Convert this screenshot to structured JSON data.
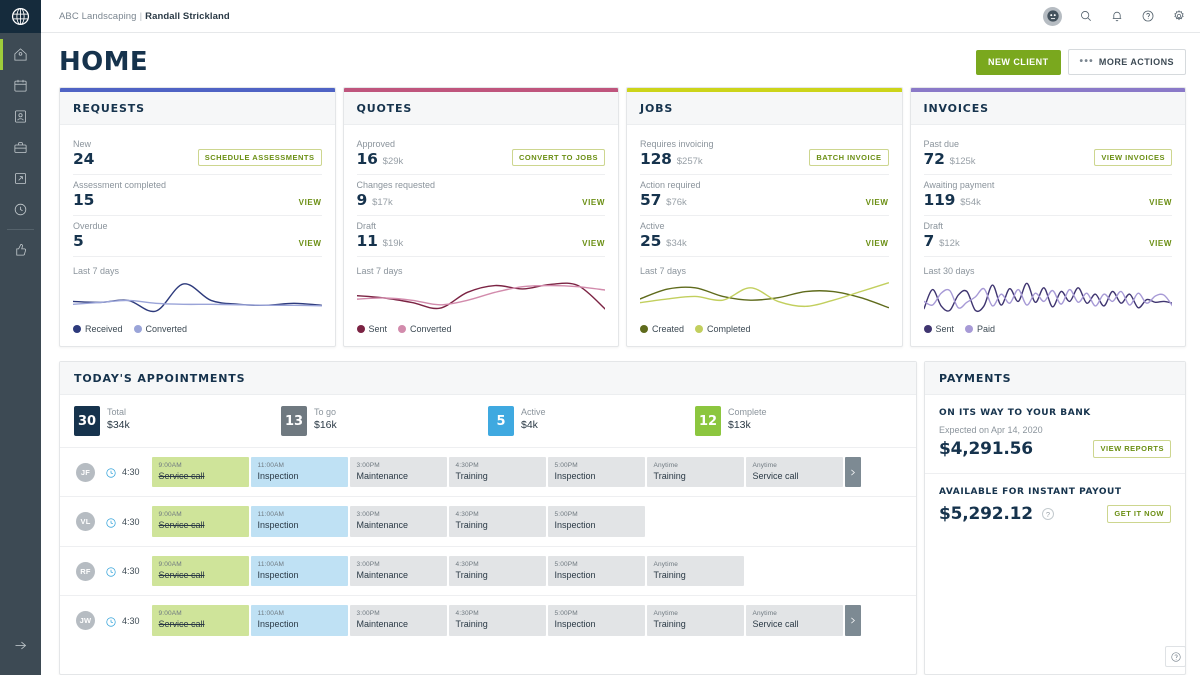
{
  "sidebar": {
    "logo_icon": "jobber-logo-icon",
    "items": [
      {
        "icon": "home-icon",
        "name": "home",
        "active": true
      },
      {
        "icon": "calendar-icon",
        "name": "schedule",
        "active": false
      },
      {
        "icon": "clients-icon",
        "name": "clients",
        "active": false
      },
      {
        "icon": "briefcase-icon",
        "name": "jobs",
        "active": false
      },
      {
        "icon": "invoice-icon",
        "name": "invoices",
        "active": false
      },
      {
        "icon": "clock-icon",
        "name": "timesheets",
        "active": false
      },
      {
        "icon": "thumbs-up-icon",
        "name": "reviews",
        "active": false
      }
    ],
    "expand_icon": "arrow-right-icon"
  },
  "topbar": {
    "company": "ABC Landscaping",
    "separator": "|",
    "user": "Randall Strickland",
    "icons": [
      "avatar-icon",
      "search-icon",
      "bell-icon",
      "help-circle-icon",
      "gear-icon"
    ]
  },
  "header": {
    "title": "HOME",
    "new_client_label": "NEW CLIENT",
    "more_actions_label": "MORE ACTIONS",
    "more_actions_dots": "•••"
  },
  "colors": {
    "requests_accent": "#4f63c4",
    "quotes_accent": "#bf557d",
    "jobs_accent": "#ccd41a",
    "invoices_accent": "#8a79c8",
    "green_primary": "#7aa81e",
    "navy": "#16334d"
  },
  "cards": [
    {
      "title": "REQUESTS",
      "accent": "#4f63c4",
      "stats": [
        {
          "label": "New",
          "value": "24",
          "amount": "",
          "action": "SCHEDULE ASSESSMENTS",
          "action_type": "pill"
        },
        {
          "label": "Assessment completed",
          "value": "15",
          "amount": "",
          "action": "VIEW",
          "action_type": "link"
        },
        {
          "label": "Overdue",
          "value": "5",
          "amount": "",
          "action": "VIEW",
          "action_type": "link"
        }
      ],
      "chart_data": {
        "type": "line",
        "title": "Last 7 days",
        "x": [
          0,
          1,
          2,
          3,
          4,
          5,
          6,
          7,
          8,
          9
        ],
        "series": [
          {
            "name": "Received",
            "color": "#2d3a7c",
            "values": [
              28,
              26,
              30,
              8,
              64,
              30,
              22,
              20,
              24,
              20
            ]
          },
          {
            "name": "Converted",
            "color": "#9aa4d8",
            "values": [
              22,
              26,
              30,
              24,
              22,
              22,
              21,
              20,
              20,
              19
            ]
          }
        ],
        "ylim": [
          0,
          70
        ],
        "grid": false,
        "legend": "bottom"
      }
    },
    {
      "title": "QUOTES",
      "accent": "#bf557d",
      "stats": [
        {
          "label": "Approved",
          "value": "16",
          "amount": "$29k",
          "action": "CONVERT TO JOBS",
          "action_type": "pill"
        },
        {
          "label": "Changes requested",
          "value": "9",
          "amount": "$17k",
          "action": "VIEW",
          "action_type": "link"
        },
        {
          "label": "Draft",
          "value": "11",
          "amount": "$19k",
          "action": "VIEW",
          "action_type": "link"
        }
      ],
      "chart_data": {
        "type": "line",
        "title": "Last 7 days",
        "x": [
          0,
          1,
          2,
          3,
          4,
          5,
          6,
          7,
          8,
          9
        ],
        "series": [
          {
            "name": "Sent",
            "color": "#7b2343",
            "values": [
              34,
              30,
              22,
              12,
              40,
              52,
              46,
              54,
              52,
              10
            ]
          },
          {
            "name": "Converted",
            "color": "#d28bac",
            "values": [
              28,
              30,
              26,
              18,
              26,
              40,
              50,
              52,
              50,
              44
            ]
          }
        ],
        "ylim": [
          0,
          60
        ],
        "grid": false,
        "legend": "bottom"
      }
    },
    {
      "title": "JOBS",
      "accent": "#ccd41a",
      "stats": [
        {
          "label": "Requires invoicing",
          "value": "128",
          "amount": "$257k",
          "action": "BATCH INVOICE",
          "action_type": "pill"
        },
        {
          "label": "Action required",
          "value": "57",
          "amount": "$76k",
          "action": "VIEW",
          "action_type": "link"
        },
        {
          "label": "Active",
          "value": "25",
          "amount": "$34k",
          "action": "VIEW",
          "action_type": "link"
        }
      ],
      "chart_data": {
        "type": "line",
        "title": "Last 7 days",
        "x": [
          0,
          1,
          2,
          3,
          4,
          5,
          6,
          7,
          8,
          9
        ],
        "series": [
          {
            "name": "Created",
            "color": "#5f6b1c",
            "values": [
              26,
              42,
              44,
              30,
              24,
              28,
              38,
              38,
              28,
              12
            ]
          },
          {
            "name": "Completed",
            "color": "#c2cf5e",
            "values": [
              20,
              26,
              30,
              24,
              44,
              22,
              14,
              24,
              38,
              52
            ]
          }
        ],
        "ylim": [
          0,
          55
        ],
        "grid": false,
        "legend": "bottom"
      }
    },
    {
      "title": "INVOICES",
      "accent": "#8a79c8",
      "stats": [
        {
          "label": "Past due",
          "value": "72",
          "amount": "$125k",
          "action": "VIEW INVOICES",
          "action_type": "pill"
        },
        {
          "label": "Awaiting payment",
          "value": "119",
          "amount": "$54k",
          "action": "VIEW",
          "action_type": "link"
        },
        {
          "label": "Draft",
          "value": "7",
          "amount": "$12k",
          "action": "VIEW",
          "action_type": "link"
        }
      ],
      "chart_data": {
        "type": "line",
        "title": "Last 30 days",
        "x": [
          0,
          1,
          2,
          3,
          4,
          5,
          6,
          7,
          8,
          9,
          10,
          11,
          12,
          13,
          14,
          15,
          16,
          17,
          18,
          19,
          20,
          21,
          22,
          23,
          24,
          25,
          26,
          27,
          28,
          29
        ],
        "series": [
          {
            "name": "Sent",
            "color": "#3f3570",
            "values": [
              14,
              56,
              20,
              10,
              44,
              52,
              10,
              20,
              66,
              22,
              58,
              30,
              70,
              28,
              60,
              18,
              52,
              30,
              60,
              26,
              46,
              20,
              52,
              26,
              46,
              16,
              34,
              28,
              30,
              26
            ]
          },
          {
            "name": "Paid",
            "color": "#a79ad6",
            "values": [
              30,
              22,
              48,
              54,
              16,
              28,
              40,
              58,
              20,
              46,
              26,
              56,
              22,
              48,
              30,
              54,
              24,
              56,
              28,
              48,
              20,
              46,
              30,
              52,
              22,
              48,
              26,
              42,
              44,
              20
            ]
          }
        ],
        "ylim": [
          0,
          75
        ],
        "grid": false,
        "legend": "bottom"
      }
    }
  ],
  "appointments": {
    "title": "TODAY'S APPOINTMENTS",
    "summary": [
      {
        "count": "30",
        "label": "Total",
        "amount": "$34k",
        "color": "#16334d"
      },
      {
        "count": "13",
        "label": "To go",
        "amount": "$16k",
        "color": "#6f7980"
      },
      {
        "count": "5",
        "label": "Active",
        "amount": "$4k",
        "color": "#3fa9e0"
      },
      {
        "count": "12",
        "label": "Complete",
        "amount": "$13k",
        "color": "#8cc63f"
      }
    ],
    "rows": [
      {
        "initials": "JF",
        "time": "4:30",
        "has_more": true,
        "blocks": [
          {
            "time": "9:00AM",
            "name": "Service call",
            "style": "green"
          },
          {
            "time": "11:00AM",
            "name": "Inspection",
            "style": "blue"
          },
          {
            "time": "3:00PM",
            "name": "Maintenance",
            "style": "grey"
          },
          {
            "time": "4:30PM",
            "name": "Training",
            "style": "grey"
          },
          {
            "time": "5:00PM",
            "name": "Inspection",
            "style": "grey"
          },
          {
            "time": "Anytime",
            "name": "Training",
            "style": "grey"
          },
          {
            "time": "Anytime",
            "name": "Service call",
            "style": "grey"
          }
        ]
      },
      {
        "initials": "VL",
        "time": "4:30",
        "has_more": false,
        "blocks": [
          {
            "time": "9:00AM",
            "name": "Service call",
            "style": "green"
          },
          {
            "time": "11:00AM",
            "name": "Inspection",
            "style": "blue"
          },
          {
            "time": "3:00PM",
            "name": "Maintenance",
            "style": "grey"
          },
          {
            "time": "4:30PM",
            "name": "Training",
            "style": "grey"
          },
          {
            "time": "5:00PM",
            "name": "Inspection",
            "style": "grey"
          }
        ]
      },
      {
        "initials": "RF",
        "time": "4:30",
        "has_more": false,
        "blocks": [
          {
            "time": "9:00AM",
            "name": "Service call",
            "style": "green"
          },
          {
            "time": "11:00AM",
            "name": "Inspection",
            "style": "blue"
          },
          {
            "time": "3:00PM",
            "name": "Maintenance",
            "style": "grey"
          },
          {
            "time": "4:30PM",
            "name": "Training",
            "style": "grey"
          },
          {
            "time": "5:00PM",
            "name": "Inspection",
            "style": "grey"
          },
          {
            "time": "Anytime",
            "name": "Training",
            "style": "grey"
          }
        ]
      },
      {
        "initials": "JW",
        "time": "4:30",
        "has_more": true,
        "blocks": [
          {
            "time": "9:00AM",
            "name": "Service call",
            "style": "green"
          },
          {
            "time": "11:00AM",
            "name": "Inspection",
            "style": "blue"
          },
          {
            "time": "3:00PM",
            "name": "Maintenance",
            "style": "grey"
          },
          {
            "time": "4:30PM",
            "name": "Training",
            "style": "grey"
          },
          {
            "time": "5:00PM",
            "name": "Inspection",
            "style": "grey"
          },
          {
            "time": "Anytime",
            "name": "Training",
            "style": "grey"
          },
          {
            "time": "Anytime",
            "name": "Service call",
            "style": "grey"
          }
        ]
      }
    ]
  },
  "payments": {
    "title": "PAYMENTS",
    "bank": {
      "heading": "ON ITS WAY TO YOUR BANK",
      "sub": "Expected on Apr 14, 2020",
      "amount": "$4,291.56",
      "button": "VIEW REPORTS"
    },
    "instant": {
      "heading": "AVAILABLE FOR INSTANT PAYOUT",
      "amount": "$5,292.12",
      "help": "?",
      "button": "GET IT NOW"
    }
  },
  "help_float": {
    "icon": "help-circle-icon"
  }
}
